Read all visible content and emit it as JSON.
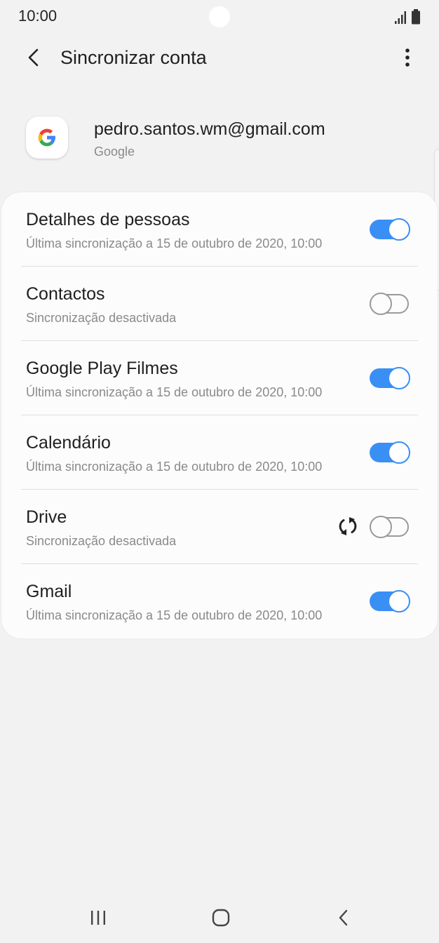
{
  "status_bar": {
    "time": "10:00"
  },
  "app_bar": {
    "title": "Sincronizar conta"
  },
  "account": {
    "email": "pedro.santos.wm@gmail.com",
    "provider": "Google"
  },
  "sync_items": [
    {
      "title": "Detalhes de pessoas",
      "subtitle": "Última sincronização a 15 de outubro de 2020, 10:00",
      "enabled": true
    },
    {
      "title": "Contactos",
      "subtitle": "Sincronização desactivada",
      "enabled": false
    },
    {
      "title": "Google Play Filmes",
      "subtitle": "Última sincronização a 15 de outubro de 2020, 10:00",
      "enabled": true
    },
    {
      "title": "Calendário",
      "subtitle": "Última sincronização a 15 de outubro de 2020, 10:00",
      "enabled": true
    },
    {
      "title": "Drive",
      "subtitle": "Sincronização desactivada",
      "enabled": false,
      "syncing": true
    },
    {
      "title": "Gmail",
      "subtitle": "Última sincronização a 15 de outubro de 2020, 10:00",
      "enabled": true
    }
  ],
  "icons": {
    "back": "back-arrow-icon",
    "more": "more-vertical-icon",
    "avatar": "google-logo-icon",
    "sync": "sync-icon",
    "nav_recents": "recents-icon",
    "nav_home": "home-icon",
    "nav_back": "nav-back-icon"
  },
  "colors": {
    "accent": "#3a8ff5",
    "background": "#f2f2f2",
    "card": "#fcfcfc",
    "secondary_text": "#8a8a8a"
  }
}
